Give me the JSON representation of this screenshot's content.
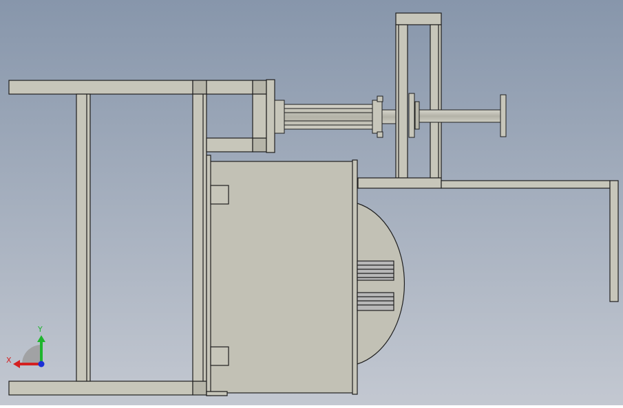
{
  "viewport": {
    "background_top": "#8796ab",
    "background_bottom": "#c3c8d1"
  },
  "model": {
    "part_fill": "#c7c6ba",
    "part_fill_dark": "#b6b5a9",
    "drum_fill": "#c2c1b5",
    "edge_color": "#1e1e1e",
    "slot_fill": "#b8b8b8"
  },
  "triad": {
    "x_label": "X",
    "y_label": "Y",
    "x_color": "#d42020",
    "y_color": "#1fb52e",
    "z_color": "#1a2fd6"
  }
}
